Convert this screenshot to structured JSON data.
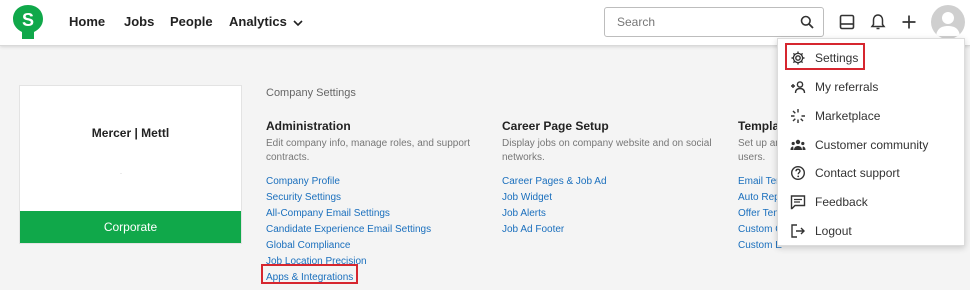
{
  "nav": {
    "logo_letter": "S",
    "items": [
      {
        "label": "Home"
      },
      {
        "label": "Jobs"
      },
      {
        "label": "People"
      },
      {
        "label": "Analytics"
      }
    ],
    "search_placeholder": "Search"
  },
  "company": {
    "name": "Mercer | Mettl",
    "plan": "Corporate",
    "dot": "·"
  },
  "settings": {
    "title": "Company Settings",
    "columns": [
      {
        "title": "Administration",
        "description": "Edit company info, manage roles, and support contracts.",
        "links": [
          "Company Profile",
          "Security Settings",
          "All-Company Email Settings",
          "Candidate Experience Email Settings",
          "Global Compliance",
          "Job Location Precision",
          "Apps & Integrations"
        ]
      },
      {
        "title": "Career Page Setup",
        "description": "Display jobs on company website and on social networks.",
        "links": [
          "Career Pages & Job Ad",
          "Job Widget",
          "Job Alerts",
          "Job Ad Footer"
        ]
      },
      {
        "title": "Templa",
        "description": "Set up an users.",
        "links": [
          "Email Ter",
          "Auto Rep",
          "Offer Ten",
          "Custom C",
          "Custom E"
        ]
      }
    ]
  },
  "dropdown": {
    "items": [
      {
        "label": "Settings",
        "icon": "gear-icon"
      },
      {
        "label": "My referrals",
        "icon": "add-person-icon"
      },
      {
        "label": "Marketplace",
        "icon": "sparkle-icon"
      },
      {
        "label": "Customer community",
        "icon": "community-icon"
      },
      {
        "label": "Contact support",
        "icon": "help-icon"
      },
      {
        "label": "Feedback",
        "icon": "feedback-icon"
      },
      {
        "label": "Logout",
        "icon": "logout-icon"
      }
    ]
  },
  "colors": {
    "brand_green": "#10a84a",
    "link_blue": "#1a6fbd",
    "highlight_red": "#d6262f"
  }
}
